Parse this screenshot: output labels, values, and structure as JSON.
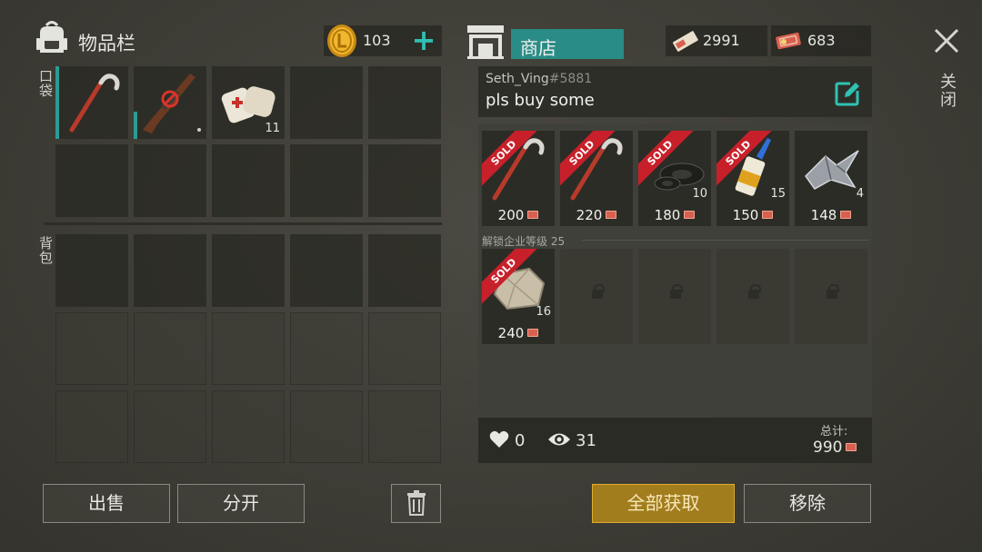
{
  "inventory": {
    "title": "物品栏",
    "pocket_label": "口袋",
    "backpack_label": "背包",
    "coins": "103",
    "items": [
      {
        "name": "crowbar",
        "count": ""
      },
      {
        "name": "rifle",
        "count": ""
      },
      {
        "name": "bandage",
        "count": "11"
      }
    ]
  },
  "shop": {
    "tab_label": "商店",
    "currency1": "2991",
    "currency2": "683",
    "seller_name": "Seth_Ving",
    "seller_tag": "#5881",
    "message": "pls buy some",
    "listings": [
      {
        "item": "crowbar",
        "sold": "SOLD",
        "qty": "",
        "price": "200"
      },
      {
        "item": "crowbar",
        "sold": "SOLD",
        "qty": "",
        "price": "220"
      },
      {
        "item": "duct-tape",
        "sold": "SOLD",
        "qty": "10",
        "price": "180"
      },
      {
        "item": "glue",
        "sold": "SOLD",
        "qty": "15",
        "price": "150"
      },
      {
        "item": "scrap-metal",
        "sold": "",
        "qty": "4",
        "price": "148"
      },
      {
        "item": "stone",
        "sold": "SOLD",
        "qty": "16",
        "price": "240"
      }
    ],
    "unlock_label": "解锁企业等级 25",
    "likes": "0",
    "views": "31",
    "total_label": "总计:",
    "total": "990"
  },
  "buttons": {
    "sell": "出售",
    "split": "分开",
    "get_all": "全部获取",
    "remove": "移除",
    "close": "关闭"
  },
  "colors": {
    "accent": "#2a8c86",
    "add": "#2fc1b2",
    "sold": "#c8202a",
    "get_all": "#a27d1d"
  }
}
